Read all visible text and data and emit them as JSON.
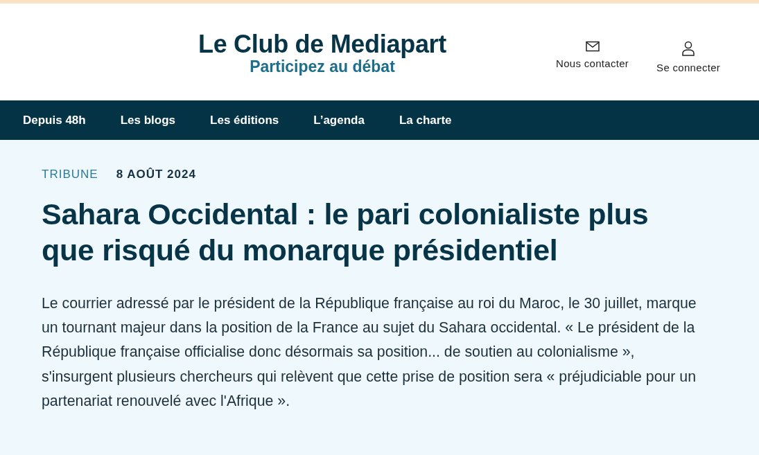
{
  "header": {
    "title": "Le Club de Mediapart",
    "tagline": "Participez au débat",
    "actions": [
      {
        "kind": "mail",
        "label": "Nous contacter"
      },
      {
        "kind": "user",
        "label": "Se connecter"
      }
    ]
  },
  "nav": [
    "Depuis 48h",
    "Les blogs",
    "Les éditions",
    "L’agenda",
    "La charte"
  ],
  "article": {
    "category": "TRIBUNE",
    "date": "8 AOÛT 2024",
    "headline": "Sahara Occidental : le pari colonialiste plus que risqué du monarque présidentiel",
    "lead": "Le courrier adressé par le président de la République française au roi du Maroc, le 30 juillet, marque un tournant majeur dans la position de la France au sujet du Sahara occidental. « Le président de la République française officialise donc désormais sa position... de soutien au colonialisme », s'insurgent plusieurs chercheurs qui relèvent que cette prise de position sera « préjudiciable pour un partenariat renouvelé avec l'Afrique »."
  }
}
